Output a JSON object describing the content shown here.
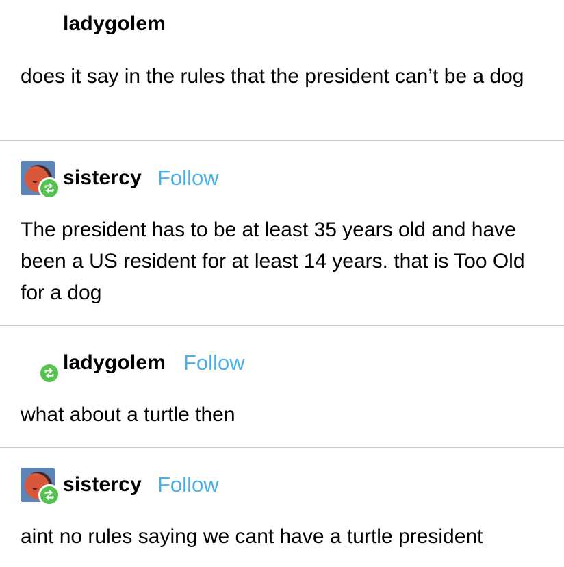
{
  "posts": [
    {
      "username": "ladygolem",
      "show_follow": false,
      "body": "does it say in the rules that the president can’t be a dog"
    },
    {
      "username": "sistercy",
      "follow_label": "Follow",
      "body": "The president has to be at least 35 years old and have been a US resident for at least 14 years. that is Too Old for a dog"
    },
    {
      "username": "ladygolem",
      "follow_label": "Follow",
      "body": "what about a turtle then"
    },
    {
      "username": "sistercy",
      "follow_label": "Follow",
      "body": "aint no rules saying we cant have a turtle president"
    }
  ],
  "colors": {
    "follow": "#4ab0ea",
    "reblog_badge": "#56c151",
    "divider": "#c9c9c9",
    "avatar_bg": "#5d84b8",
    "avatar_face": "#d9583c"
  },
  "icons": {
    "reblog": "reblog-icon",
    "avatar": "avatar-icon"
  }
}
